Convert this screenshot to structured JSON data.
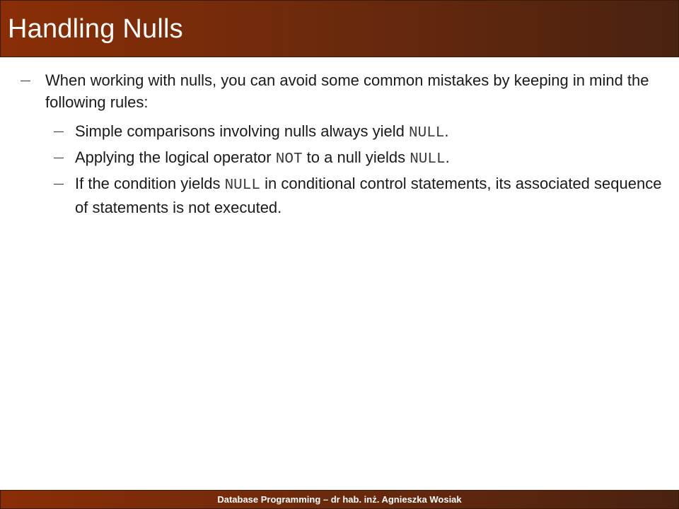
{
  "slide": {
    "title": "Handling Nulls"
  },
  "body": {
    "intro": "When working with nulls, you can avoid some common mistakes by keeping in mind the following rules:",
    "rules": [
      {
        "pre": "Simple comparisons involving nulls always yield ",
        "code": "NULL",
        "post": "."
      },
      {
        "pre": "Applying the logical operator ",
        "code": "NOT",
        "mid": " to a null yields ",
        "code2": "NULL",
        "post": "."
      },
      {
        "pre": "If the condition yields ",
        "code": "NULL",
        "post": " in conditional control statements, its associated sequence of statements is not executed."
      }
    ]
  },
  "footer": {
    "text": "Database Programming – dr hab. inż. Agnieszka Wosiak"
  },
  "colors": {
    "bar_start": "#8a2e06",
    "bar_end": "#4a2210",
    "title_text": "#ffffff"
  }
}
